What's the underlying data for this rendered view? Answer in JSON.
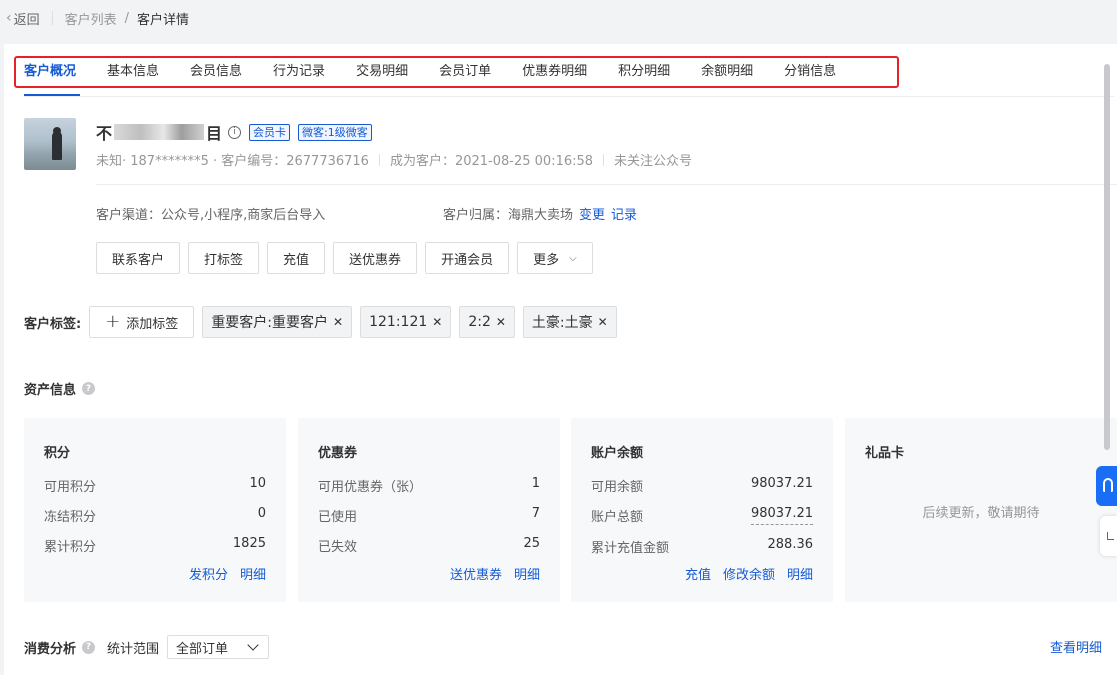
{
  "breadcrumb": {
    "back": "返回",
    "list": "客户列表",
    "slash": "/",
    "current": "客户详情"
  },
  "tabs": [
    "客户概况",
    "基本信息",
    "会员信息",
    "行为记录",
    "交易明细",
    "会员订单",
    "优惠券明细",
    "积分明细",
    "余额明细",
    "分销信息"
  ],
  "customer": {
    "name_prefix": "不",
    "name_suffix": "目",
    "badge_card": "会员卡",
    "badge_wechat": "微客:1级微客",
    "meta_phone": "未知· 187*******5 · 客户编号：2677736716",
    "meta_since": "成为客户：2021-08-25 00:16:58",
    "meta_follow": "未关注公众号",
    "channel": "客户渠道：公众号,小程序,商家后台导入",
    "owner_label": "客户归属：海鼎大卖场",
    "owner_change": "变更",
    "owner_record": "记录"
  },
  "actions": [
    "联系客户",
    "打标签",
    "充值",
    "送优惠券",
    "开通会员",
    "更多"
  ],
  "labels": {
    "title": "客户标签:",
    "add": "添加标签",
    "chips": [
      "重要客户:重要客户",
      "121:121",
      "2:2",
      "土豪:土豪"
    ]
  },
  "assets": {
    "title": "资产信息",
    "points": {
      "title": "积分",
      "rows": [
        {
          "label": "可用积分",
          "value": "10"
        },
        {
          "label": "冻结积分",
          "value": "0"
        },
        {
          "label": "累计积分",
          "value": "1825"
        }
      ],
      "links": [
        "发积分",
        "明细"
      ]
    },
    "coupons": {
      "title": "优惠券",
      "rows": [
        {
          "label": "可用优惠券（张）",
          "value": "1"
        },
        {
          "label": "已使用",
          "value": "7"
        },
        {
          "label": "已失效",
          "value": "25"
        }
      ],
      "links": [
        "送优惠券",
        "明细"
      ]
    },
    "balance": {
      "title": "账户余额",
      "rows": [
        {
          "label": "可用余额",
          "value": "98037.21"
        },
        {
          "label": "账户总额",
          "value": "98037.21"
        },
        {
          "label": "累计充值金额",
          "value": "288.36"
        }
      ],
      "links": [
        "充值",
        "修改余额",
        "明细"
      ]
    },
    "giftcard": {
      "title": "礼品卡",
      "placeholder": "后续更新，敬请期待"
    }
  },
  "consume": {
    "title": "消费分析",
    "range_label": "统计范围",
    "range_value": "全部订单",
    "view_detail": "查看明细"
  },
  "colors": {
    "accent": "#155bd4",
    "highlight_border": "#e6212a",
    "card_bg": "#f7f8fa"
  }
}
